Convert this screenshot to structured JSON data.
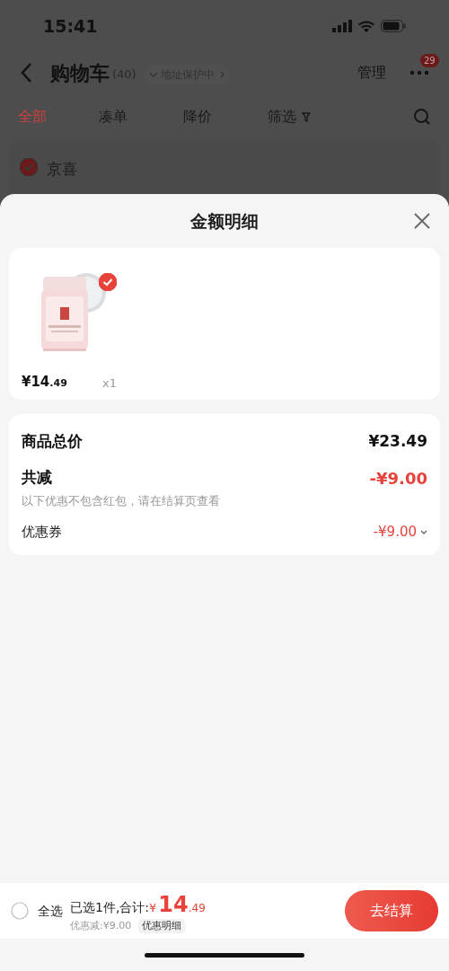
{
  "status_bar": {
    "time": "15:41"
  },
  "nav": {
    "title": "购物车",
    "count": "(40)",
    "address": "地址保护中",
    "manage": "管理",
    "badge": "29"
  },
  "tabs": [
    {
      "label": "全部",
      "selected": true
    },
    {
      "label": "凑单",
      "selected": false
    },
    {
      "label": "降价",
      "selected": false
    },
    {
      "label": "筛选",
      "selected": false
    }
  ],
  "store": {
    "name": "京喜",
    "checked": true
  },
  "sheet": {
    "title": "金额明细",
    "items": [
      {
        "kind": "picture",
        "selected": true,
        "price": "¥14.49",
        "quantity": "x1"
      }
    ],
    "summary": [
      {
        "kind": "total",
        "label": "商品总价",
        "value": "¥23.49"
      },
      {
        "kind": "discount",
        "label": "共减",
        "value": "-¥9.00",
        "note": "以下优惠不包含红包，请在结算页查看"
      },
      {
        "kind": "coupon",
        "label": "优惠券",
        "value": "-¥9.00"
      }
    ]
  },
  "footer": {
    "select_all": "全选",
    "checked": false,
    "selected_text": "已选1件,合计:",
    "total": "¥14.49",
    "discount": "优惠减:¥9.00",
    "detail": "优惠明细",
    "checkout": "去结算"
  }
}
